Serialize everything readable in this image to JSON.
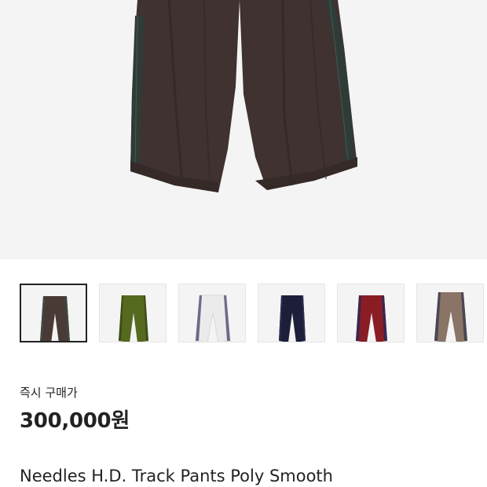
{
  "product": {
    "instant_buy_label": "즉시 구매가",
    "price": "300,000원",
    "title": "Needles H.D. Track Pants Poly Smooth"
  },
  "gallery": {
    "selected_index": 0,
    "thumbnails": [
      {
        "name": "brown",
        "body": "#4a3a36",
        "stripe": "#3e4a44"
      },
      {
        "name": "olive",
        "body": "#55691f",
        "stripe": "#3d4d17"
      },
      {
        "name": "white",
        "body": "#ebebeb",
        "stripe": "#6a6a8a"
      },
      {
        "name": "navy",
        "body": "#1d1f3a",
        "stripe": "#2b2d50"
      },
      {
        "name": "red",
        "body": "#8a1c24",
        "stripe": "#3c2550"
      },
      {
        "name": "taupe",
        "body": "#8a7466",
        "stripe": "#4a4654"
      }
    ]
  },
  "colors": {
    "hero_background": "#f4f4f4",
    "hero_pants": "#3f3230",
    "hero_stripe": "#2f3b36"
  }
}
